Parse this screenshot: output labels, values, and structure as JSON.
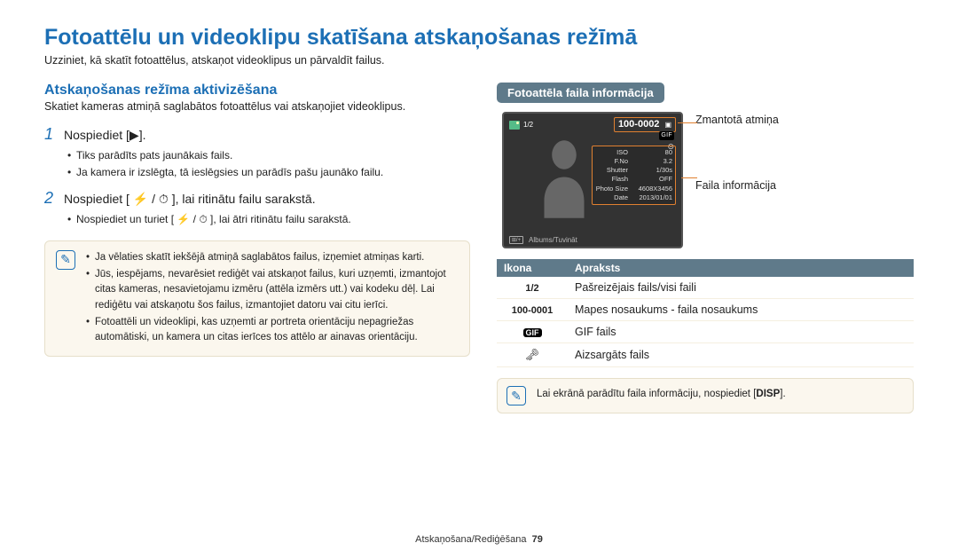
{
  "title": "Fotoattēlu un videoklipu skatīšana atskaņošanas režīmā",
  "subtitle": "Uzziniet, kā skatīt fotoattēlus, atskaņot videoklipus un pārvaldīt failus.",
  "left": {
    "heading": "Atskaņošanas režīma aktivizēšana",
    "sub": "Skatiet kameras atmiņā saglabātos fotoattēlus vai atskaņojiet videoklipus.",
    "step1": {
      "num": "1",
      "text": "Nospiediet [▶].",
      "b1": "Tiks parādīts pats jaunākais fails.",
      "b2": "Ja kamera ir izslēgta, tā ieslēgsies un parādīs pašu jaunāko failu."
    },
    "step2": {
      "num": "2",
      "text": "Nospiediet [ ⚡ / ⏱ ], lai ritinātu failu sarakstā.",
      "b1": "Nospiediet un turiet [ ⚡ / ⏱ ], lai ātri ritinātu failu sarakstā."
    },
    "note1": "Ja vēlaties skatīt iekšējā atmiņā saglabātos failus, izņemiet atmiņas karti.",
    "note2": "Jūs, iespējams, nevarēsiet rediģēt vai atskaņot failus, kuri uzņemti, izmantojot citas kameras, nesavietojamu izmēru (attēla izmērs utt.) vai kodeku dēļ. Lai rediģētu vai atskaņotu šos failus, izmantojiet datoru vai citu ierīci.",
    "note3": "Fotoattēli un videoklipi, kas uzņemti ar portreta orientāciju nepagriežas automātiski, un kamera un citas ierīces tos attēlo ar ainavas orientāciju."
  },
  "right": {
    "pill": "Fotoattēla faila informācija",
    "callout1": "Zmantotā atmiņa",
    "callout2": "Faila informācija",
    "screen": {
      "count": "1/2",
      "folder": "100-0002",
      "gif": "GIF",
      "info": {
        "iso_l": "ISO",
        "iso_v": "80",
        "fno_l": "F.No",
        "fno_v": "3.2",
        "sh_l": "Shutter",
        "sh_v": "1/30s",
        "fl_l": "Flash",
        "fl_v": "OFF",
        "ps_l": "Photo Size",
        "ps_v": "4608X3456",
        "dt_l": "Date",
        "dt_v": "2013/01/01"
      },
      "bottom": "Albums/Tuvināt"
    },
    "table": {
      "h1": "Ikona",
      "h2": "Apraksts",
      "r1_i": "1/2",
      "r1_d": "Pašreizējais fails/visi faili",
      "r2_i": "100-0001",
      "r2_d": "Mapes nosaukums - faila nosaukums",
      "r3_i": "GIF",
      "r3_d": "GIF fails",
      "r4_d": "Aizsargāts fails"
    },
    "tip": "Lai ekrānā parādītu faila informāciju, nospiediet [",
    "tip_btn": "DISP",
    "tip_end": "]."
  },
  "footer": {
    "section": "Atskaņošana/Rediģēšana",
    "page": "79"
  }
}
